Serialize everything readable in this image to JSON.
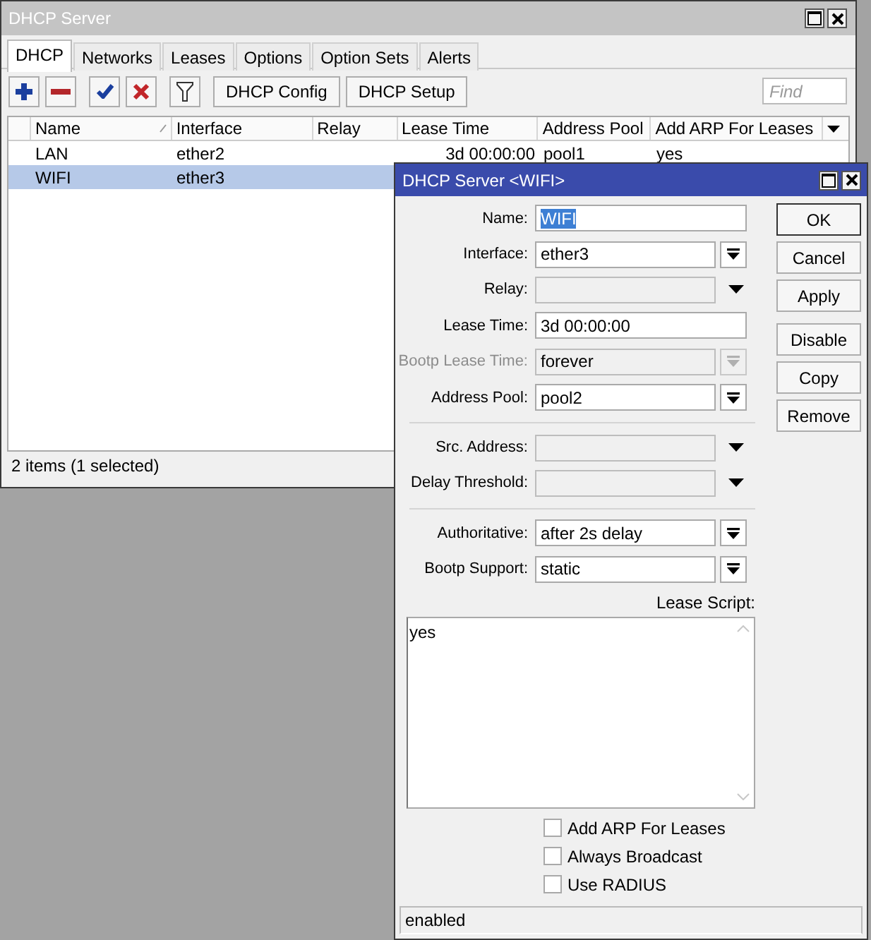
{
  "main_window": {
    "title": "DHCP Server",
    "tabs": [
      {
        "label": "DHCP",
        "selected": true
      },
      {
        "label": "Networks",
        "selected": false
      },
      {
        "label": "Leases",
        "selected": false
      },
      {
        "label": "Options",
        "selected": false
      },
      {
        "label": "Option Sets",
        "selected": false
      },
      {
        "label": "Alerts",
        "selected": false
      }
    ],
    "toolbar": [
      {
        "kind": "add"
      },
      {
        "kind": "remove"
      },
      {
        "kind": "enable"
      },
      {
        "kind": "disable"
      },
      {
        "kind": "filter"
      },
      {
        "kind": "text",
        "label": "DHCP Config"
      },
      {
        "kind": "text",
        "label": "DHCP Setup"
      }
    ],
    "find": {
      "placeholder": "Find"
    },
    "table": {
      "columns": [
        {
          "label": "Name",
          "sorted": true
        },
        {
          "label": "Interface",
          "sorted": false
        },
        {
          "label": "Relay",
          "sorted": false
        },
        {
          "label": "Lease Time",
          "sorted": false
        },
        {
          "label": "Address Pool",
          "sorted": false
        },
        {
          "label": "Add ARP For Leases",
          "sorted": false
        }
      ],
      "rows": [
        {
          "cells": [
            "LAN",
            "ether2",
            null,
            "3d 00:00:00",
            "pool1",
            "yes"
          ],
          "selected": false
        },
        {
          "cells": [
            "WIFI",
            "ether3"
          ],
          "selected": true
        }
      ]
    },
    "status_bar": "2 items (1 selected)"
  },
  "dialog": {
    "title": "DHCP Server <WIFI>",
    "groups": [
      {
        "fields": [
          {
            "label": "Name:",
            "kind": "text",
            "value": "WIFI",
            "text_selected": true,
            "disabled": false
          },
          {
            "label": "Interface:",
            "kind": "combo",
            "value": "ether3",
            "text_selected": false,
            "disabled": false
          },
          {
            "label": "Relay:",
            "kind": "optional",
            "disabled": false
          },
          {
            "label": "Lease Time:",
            "kind": "text",
            "value": "3d 00:00:00",
            "text_selected": false,
            "disabled": false
          },
          {
            "label": "Bootp Lease Time:",
            "kind": "combo",
            "value": "forever",
            "text_selected": false,
            "disabled": true
          },
          {
            "label": "Address Pool:",
            "kind": "combo",
            "value": "pool2",
            "text_selected": false,
            "disabled": false
          }
        ]
      },
      {
        "fields": [
          {
            "label": "Src. Address:",
            "kind": "optional",
            "disabled": false
          },
          {
            "label": "Delay Threshold:",
            "kind": "optional",
            "disabled": false
          }
        ]
      },
      {
        "fields": [
          {
            "label": "Authoritative:",
            "kind": "combo",
            "value": "after 2s delay",
            "text_selected": false,
            "disabled": false
          },
          {
            "label": "Bootp Support:",
            "kind": "combo",
            "value": "static",
            "text_selected": false,
            "disabled": false
          }
        ]
      }
    ],
    "lease_script": {
      "label": "Lease Script:",
      "value": "yes"
    },
    "checkboxes": [
      {
        "label": "Add ARP For Leases",
        "checked": false
      },
      {
        "label": "Always Broadcast",
        "checked": false
      },
      {
        "label": "Use RADIUS",
        "checked": false
      }
    ],
    "button_groups": [
      [
        {
          "label": "OK",
          "default": true
        },
        {
          "label": "Cancel",
          "default": false
        },
        {
          "label": "Apply",
          "default": false
        }
      ],
      [
        {
          "label": "Disable",
          "default": false
        },
        {
          "label": "Copy",
          "default": false
        },
        {
          "label": "Remove",
          "default": false
        }
      ]
    ],
    "status": "enabled"
  }
}
